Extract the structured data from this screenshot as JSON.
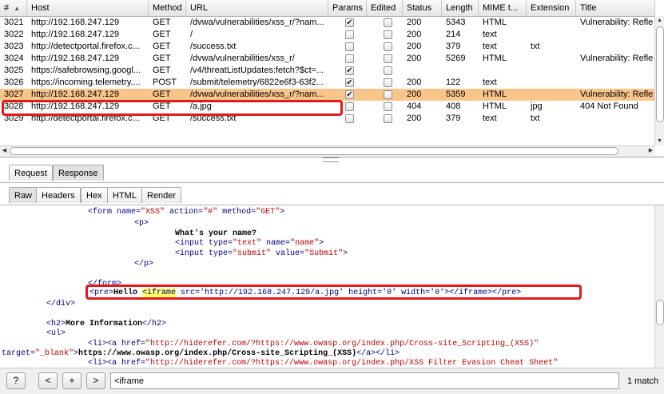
{
  "table": {
    "columns": [
      {
        "label": "#",
        "sort": "▲"
      },
      {
        "label": "Host"
      },
      {
        "label": "Method"
      },
      {
        "label": "URL"
      },
      {
        "label": "Params"
      },
      {
        "label": "Edited"
      },
      {
        "label": "Status"
      },
      {
        "label": "Length"
      },
      {
        "label": "MIME t..."
      },
      {
        "label": "Extension"
      },
      {
        "label": "Title"
      }
    ],
    "rows": [
      {
        "id": "3021",
        "host": "http://192.168.247.129",
        "method": "GET",
        "url": "/dvwa/vulnerabilities/xss_r/?nam...",
        "params": true,
        "edited": false,
        "status": "200",
        "length": "5343",
        "mime": "HTML",
        "ext": "",
        "title": "Vulnerability: Refle"
      },
      {
        "id": "3022",
        "host": "http://192.168.247.129",
        "method": "GET",
        "url": "/",
        "params": false,
        "edited": false,
        "status": "200",
        "length": "214",
        "mime": "text",
        "ext": "",
        "title": ""
      },
      {
        "id": "3023",
        "host": "http://detectportal.firefox.c...",
        "method": "GET",
        "url": "/success.txt",
        "params": false,
        "edited": false,
        "status": "200",
        "length": "379",
        "mime": "text",
        "ext": "txt",
        "title": ""
      },
      {
        "id": "3024",
        "host": "http://192.168.247.129",
        "method": "GET",
        "url": "/dvwa/vulnerabilities/xss_r/",
        "params": false,
        "edited": false,
        "status": "200",
        "length": "5269",
        "mime": "HTML",
        "ext": "",
        "title": "Vulnerability: Refle"
      },
      {
        "id": "3025",
        "host": "https://safebrowsing.googl...",
        "method": "GET",
        "url": "/v4/threatListUpdates:fetch?$ct=...",
        "params": true,
        "edited": false,
        "status": "",
        "length": "",
        "mime": "",
        "ext": "",
        "title": ""
      },
      {
        "id": "3026",
        "host": "https://incoming.telemetry....",
        "method": "POST",
        "url": "/submit/telemetry/6822e6f3-63f2...",
        "params": true,
        "edited": false,
        "status": "200",
        "length": "122",
        "mime": "text",
        "ext": "",
        "title": ""
      },
      {
        "id": "3027",
        "host": "http://192.168.247.129",
        "method": "GET",
        "url": "/dvwa/vulnerabilities/xss_r/?nam...",
        "params": true,
        "edited": false,
        "status": "200",
        "length": "5359",
        "mime": "HTML",
        "ext": "",
        "title": "Vulnerability: Refle",
        "selected": true
      },
      {
        "id": "3028",
        "host": "http://192.168.247.129",
        "method": "GET",
        "url": "/a.jpg",
        "params": false,
        "edited": false,
        "status": "404",
        "length": "408",
        "mime": "HTML",
        "ext": "jpg",
        "title": "404 Not Found"
      },
      {
        "id": "3029",
        "host": "http://detectportal.firefox.c...",
        "method": "GET",
        "url": "/success.txt",
        "params": false,
        "edited": false,
        "status": "200",
        "length": "379",
        "mime": "text",
        "ext": "txt",
        "title": ""
      }
    ]
  },
  "tabs_top": {
    "request": "Request",
    "response": "Response"
  },
  "tabs_view": {
    "raw": "Raw",
    "headers": "Headers",
    "hex": "Hex",
    "html": "HTML",
    "render": "Render"
  },
  "code": {
    "l1_form": "<form",
    "l1_name_attr": " name=",
    "l1_name_val": "\"XSS\"",
    "l1_action_attr": " action=",
    "l1_action_val": "\"#\"",
    "l1_method_attr": " method=",
    "l1_method_val": "\"GET\"",
    "l1_close": ">",
    "l2": "<p>",
    "l3": "What's your name?",
    "l4_open": "<input",
    "l4_type_attr": " type=",
    "l4_type_val": "\"text\"",
    "l4_name_attr": " name=",
    "l4_name_val": "\"name\"",
    "l4_close": ">",
    "l5_open": "<input",
    "l5_type_attr": " type=",
    "l5_type_val": "\"submit\"",
    "l5_value_attr": " value=",
    "l5_value_val": "\"Submit\"",
    "l5_close": ">",
    "l6": "</p>",
    "l7": "</form>",
    "l8_pre": "<pre>",
    "l8_hello": "Hello ",
    "l8_iframe": "<iframe",
    "l8_rest": " src='http://192.168.247.129/a.jpg' height='0' width='0'></iframe></pre>",
    "l9": "</div>",
    "l10_open": "<h2>",
    "l10_text": "More Information",
    "l10_close": "</h2>",
    "l11": "<ul>",
    "l12_open": "<li><a",
    "l12_href_attr": " href=",
    "l12_href_val": "\"http://hiderefer.com/?https://www.owasp.org/index.php/Cross-site_Scripting_(XSS)\"",
    "l13_target_attr": "target=",
    "l13_target_val": "\"_blank\"",
    "l13_gt": ">",
    "l13_text": "https://www.owasp.org/index.php/Cross-site_Scripting_(XSS)",
    "l13_close": "</a></li>",
    "l14_open": "<li><a",
    "l14_href_attr": " href=",
    "l14_href_val": "\"http://hiderefer.com/?https://www.owasp.org/index.php/XSS Filter Evasion Cheat Sheet\""
  },
  "search": {
    "help": "?",
    "prev": "<",
    "next_plus": "+",
    "next": ">",
    "value": "<iframe",
    "match_count": "1 match"
  },
  "colors": {
    "selected_row": "#f9c58a",
    "highlight_box": "#e31a1a",
    "match_highlight": "#ffff66"
  }
}
